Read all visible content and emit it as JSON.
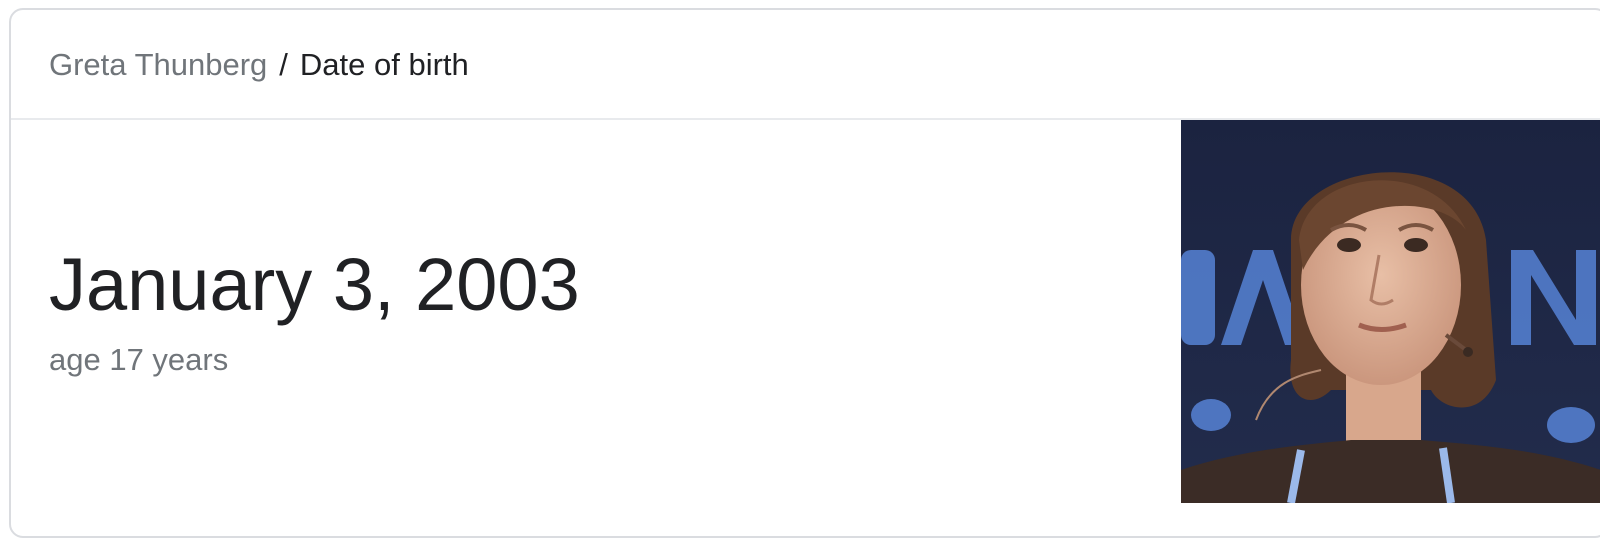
{
  "breadcrumb": {
    "entity": "Greta Thunberg",
    "separator": "/",
    "attribute": "Date of birth"
  },
  "answer": {
    "value": "January 3, 2003",
    "subtext": "age 17 years"
  },
  "image": {
    "alt": "Greta Thunberg"
  },
  "colors": {
    "primary_text": "#202124",
    "secondary_text": "#70757a",
    "border": "#dadce0",
    "photo_background": "#1c2642"
  }
}
